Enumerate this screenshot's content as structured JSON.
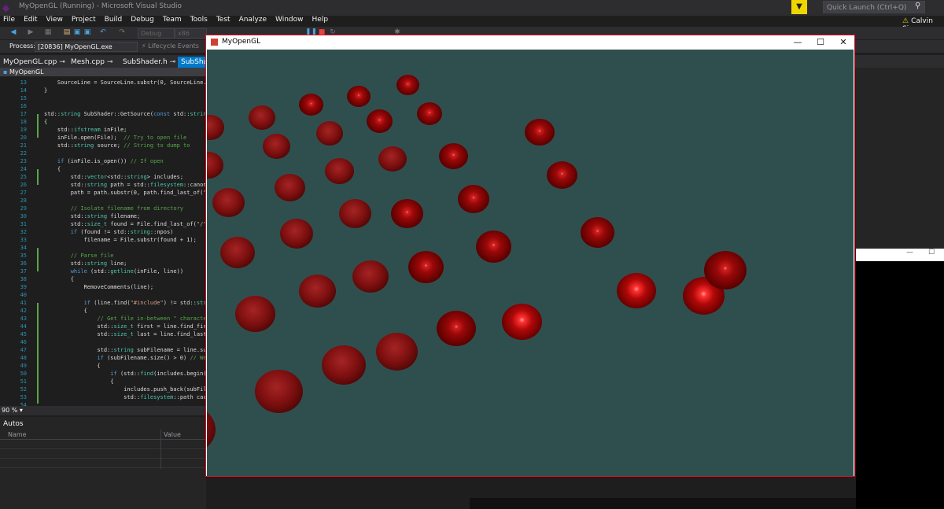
{
  "vs": {
    "title": "MyOpenGL (Running) - Microsoft Visual Studio",
    "quick_launch_placeholder": "Quick Launch (Ctrl+Q)",
    "user_name": "Calvin Simp",
    "menu": [
      "File",
      "Edit",
      "View",
      "Project",
      "Build",
      "Debug",
      "Team",
      "Tools",
      "Test",
      "Analyze",
      "Window",
      "Help"
    ],
    "toolbar": {
      "config": "Debug",
      "platform": "x86",
      "continue_label": "Continue"
    },
    "process_label": "Process:",
    "process_value": "[20836] MyOpenGL.exe",
    "lifecycle_label": "Lifecycle Events",
    "tabs": [
      "MyOpenGL.cpp",
      "Mesh.cpp",
      "SubShader.h",
      "SubShader"
    ],
    "nav_project": "MyOpenGL",
    "zoom": "90 %",
    "autos": {
      "title": "Autos",
      "col_name": "Name",
      "col_value": "Value"
    }
  },
  "code_lines": [
    {
      "n": "13",
      "t": "    SourceLine = SourceLine.substr(0, SourceLine."
    },
    {
      "n": "14",
      "t": "}"
    },
    {
      "n": "15",
      "t": ""
    },
    {
      "n": "16",
      "t": ""
    },
    {
      "n": "17",
      "t": "std::string SubShader::GetSource(const std::string"
    },
    {
      "n": "18",
      "t": "{"
    },
    {
      "n": "19",
      "t": "    std::ifstream inFile;"
    },
    {
      "n": "20",
      "t": "    inFile.open(File);  // Try to open file"
    },
    {
      "n": "21",
      "t": "    std::string source; // String to dump to"
    },
    {
      "n": "22",
      "t": ""
    },
    {
      "n": "23",
      "t": "    if (inFile.is_open()) // If open"
    },
    {
      "n": "24",
      "t": "    {"
    },
    {
      "n": "25",
      "t": "        std::vector<std::string> includes;"
    },
    {
      "n": "26",
      "t": "        std::string path = std::filesystem::canoni"
    },
    {
      "n": "27",
      "t": "        path = path.substr(0, path.find_last_of(\""
    },
    {
      "n": "28",
      "t": ""
    },
    {
      "n": "29",
      "t": "        // Isolate filename from directory"
    },
    {
      "n": "30",
      "t": "        std::string filename;"
    },
    {
      "n": "31",
      "t": "        std::size_t found = File.find_last_of(\"/\""
    },
    {
      "n": "32",
      "t": "        if (found != std::string::npos)"
    },
    {
      "n": "33",
      "t": "            filename = File.substr(found + 1);"
    },
    {
      "n": "34",
      "t": ""
    },
    {
      "n": "35",
      "t": "        // Parse file"
    },
    {
      "n": "36",
      "t": "        std::string line;"
    },
    {
      "n": "37",
      "t": "        while (std::getline(inFile, line))"
    },
    {
      "n": "38",
      "t": "        {"
    },
    {
      "n": "39",
      "t": "            RemoveComments(line);"
    },
    {
      "n": "40",
      "t": ""
    },
    {
      "n": "41",
      "t": "            if (line.find(\"#include\") != std::str"
    },
    {
      "n": "42",
      "t": "            {"
    },
    {
      "n": "43",
      "t": "                // Get file in-between \" character"
    },
    {
      "n": "44",
      "t": "                std::size_t first = line.find_firs"
    },
    {
      "n": "45",
      "t": "                std::size_t last = line.find_last_"
    },
    {
      "n": "46",
      "t": ""
    },
    {
      "n": "47",
      "t": "                std::string subFilename = line.sub"
    },
    {
      "n": "48",
      "t": "                if (subFilename.size() > 0) // We"
    },
    {
      "n": "49",
      "t": "                {"
    },
    {
      "n": "50",
      "t": "                    if (std::find(includes.begin("
    },
    {
      "n": "51",
      "t": "                    {"
    },
    {
      "n": "52",
      "t": "                        includes.push_back(subFile"
    },
    {
      "n": "53",
      "t": "                        std::filesystem::path cac"
    },
    {
      "n": "54",
      "t": ""
    }
  ],
  "gl_window": {
    "title": "MyOpenGL"
  },
  "theme": {
    "accent": "#007acc",
    "canvas_bg": "#2f4f4f",
    "sphere_color": "#8b0000"
  }
}
